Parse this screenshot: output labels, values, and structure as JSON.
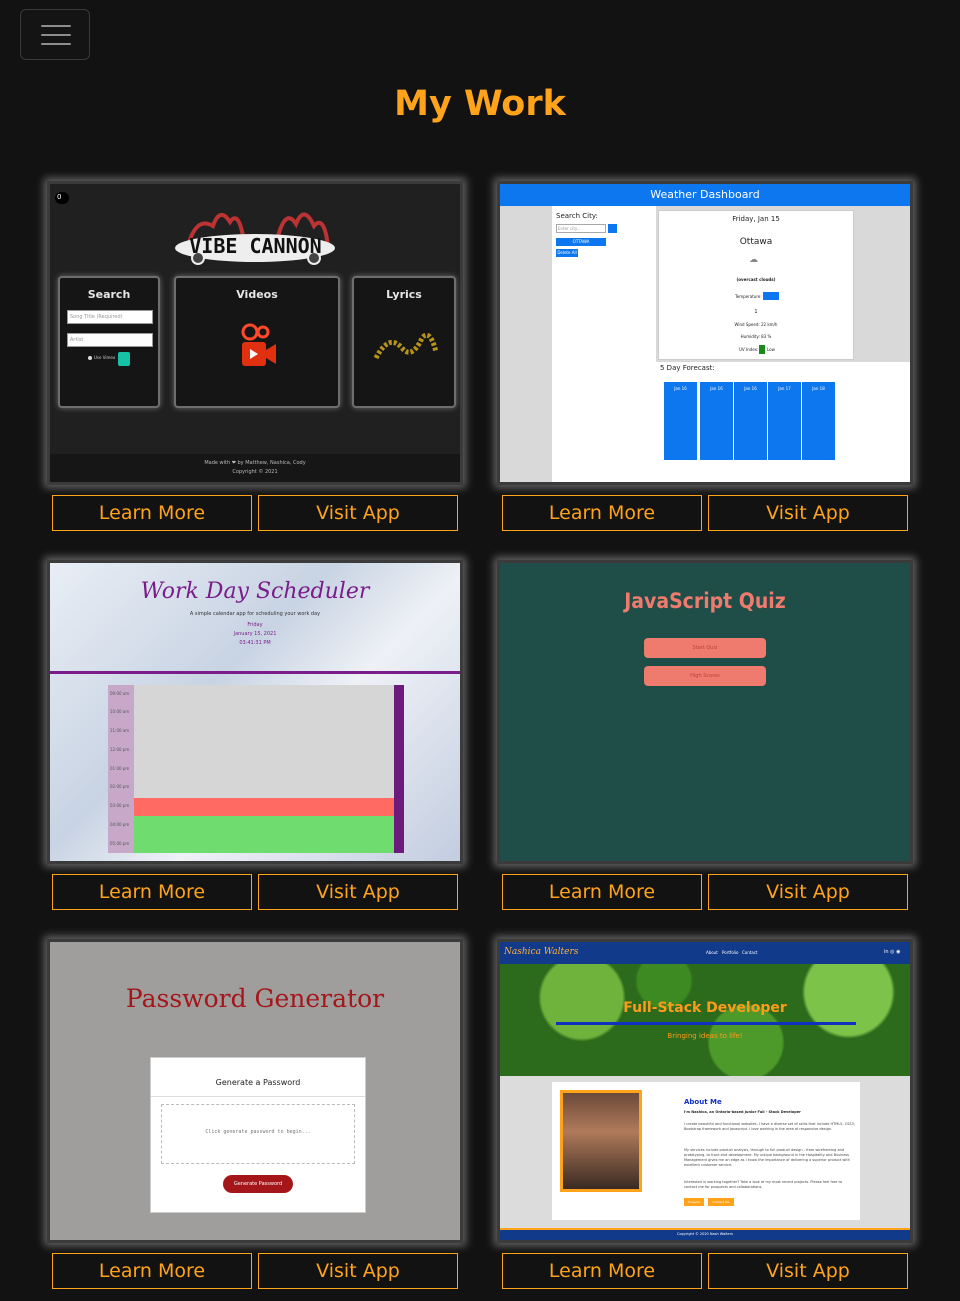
{
  "page": {
    "title": "My Work"
  },
  "nav": {
    "toggle_icon": "hamburger-menu-icon"
  },
  "buttons": {
    "learn_more": "Learn More",
    "visit_app": "Visit App"
  },
  "colors": {
    "accent": "#ffa31a",
    "background": "#121212"
  },
  "projects": [
    {
      "name": "Vibe Cannon",
      "screenshot": {
        "logo": "VIBE CANNON",
        "toggle": "0",
        "panels": [
          "Search",
          "Videos",
          "Lyrics"
        ],
        "search_placeholder_1": "Song Title (Required)",
        "search_placeholder_2": "Artist",
        "checkbox_label": "Use Vimeo",
        "footer_line_1": "Made with ❤ by Matthew, Nashica, Cody",
        "footer_line_2": "Copyright © 2021"
      }
    },
    {
      "name": "Weather Dashboard",
      "screenshot": {
        "header": "Weather Dashboard",
        "search_label": "Search City:",
        "search_placeholder": "Enter city...",
        "history_item": "OTTAWA",
        "delete_label": "Delete All",
        "date": "Friday, Jan 15",
        "city": "Ottawa",
        "condition": "(overcast clouds)",
        "temperature_label": "Temperature:",
        "temp_value": "1",
        "wind": "Wind Speed: 22 km/h",
        "humidity": "Humidity: 83 %",
        "uv": "UV Index:",
        "uv_level": "Low",
        "forecast_title": "5 Day Forecast:",
        "forecast_dates": [
          "Jan 16",
          "Jan 16",
          "Jan 16",
          "Jan 17",
          "Jan 18"
        ]
      }
    },
    {
      "name": "Work Day Scheduler",
      "screenshot": {
        "title": "Work Day Scheduler",
        "subtitle": "A simple calendar app for scheduling your work day",
        "day": "Friday",
        "date": "January 15, 2021",
        "time": "03:41:31 PM",
        "hours": [
          "09:00 am",
          "10:00 am",
          "11:00 am",
          "12:00 pm",
          "01:00 pm",
          "02:00 pm",
          "03:00 pm",
          "04:00 pm",
          "05:00 pm"
        ]
      }
    },
    {
      "name": "JavaScript Quiz",
      "screenshot": {
        "title": "JavaScript Quiz",
        "start_label": "Start Quiz",
        "scores_label": "High Scores"
      }
    },
    {
      "name": "Password Generator",
      "screenshot": {
        "title": "Password Generator",
        "card_title": "Generate a Password",
        "placeholder": "Click generate password to begin...",
        "button": "Generate Password"
      }
    },
    {
      "name": "Portfolio",
      "screenshot": {
        "brand": "Nashica Walters",
        "nav": [
          "About",
          "Portfolio",
          "Contact"
        ],
        "hero_title": "Full-Stack Developer",
        "hero_sub": "Bringing ideas to life!",
        "about_title": "About Me",
        "about_intro": "I'm Nashica, an Ontario-based Junior Full - Stack Developer",
        "about_p1": "I create beautiful and functional websites. I have a diverse set of skills that include HTML5, CSS3, Bootstrap framework and Javascript. I love working in the area of responsive design.",
        "about_p2": "My services include product analysis, through to full product design - from wireframing and prototyping, to front-end development. My unique background in the Hospitality and Business Management gives me an edge as I know the importance of delivering a superior product with excellent customer service.",
        "about_p3": "Interested in working together? Take a look at my most recent projects. Please feel free to contact me for prospects and collaborations.",
        "btn_projects": "Projects",
        "btn_contact": "Contact Me",
        "footer": "Copyright © 2020 Nash Walters"
      }
    }
  ]
}
